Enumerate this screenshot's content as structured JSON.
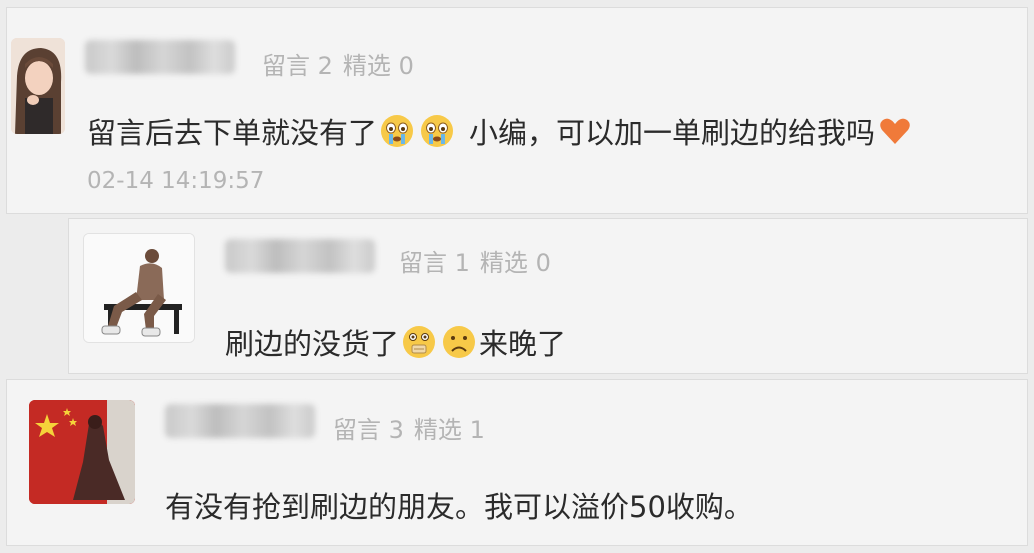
{
  "comments": [
    {
      "stats": {
        "liuyan_label": "留言",
        "liuyan_count": "2",
        "jingxuan_label": "精选",
        "jingxuan_count": "0"
      },
      "text_a": "留言后去下单就没有了",
      "text_b": "小编，可以加一单刷边的给我吗",
      "emojis": [
        "crying-face-icon",
        "crying-face-icon",
        "orange-heart-icon"
      ],
      "time": "02-14 14:19:57"
    },
    {
      "stats": {
        "liuyan_label": "留言",
        "liuyan_count": "1",
        "jingxuan_label": "精选",
        "jingxuan_count": "0"
      },
      "text_a": "刷边的没货了",
      "text_b": "来晚了",
      "emojis": [
        "zipper-mouth-face-icon",
        "sad-face-icon"
      ]
    },
    {
      "stats": {
        "liuyan_label": "留言",
        "liuyan_count": "3",
        "jingxuan_label": "精选",
        "jingxuan_count": "1"
      },
      "text": "有没有抢到刷边的朋友。我可以溢价50收购。"
    }
  ],
  "colors": {
    "background": "#ececec",
    "card": "#f4f4f4",
    "meta_text": "#b4b4b4",
    "body_text": "#2b2b2b"
  }
}
